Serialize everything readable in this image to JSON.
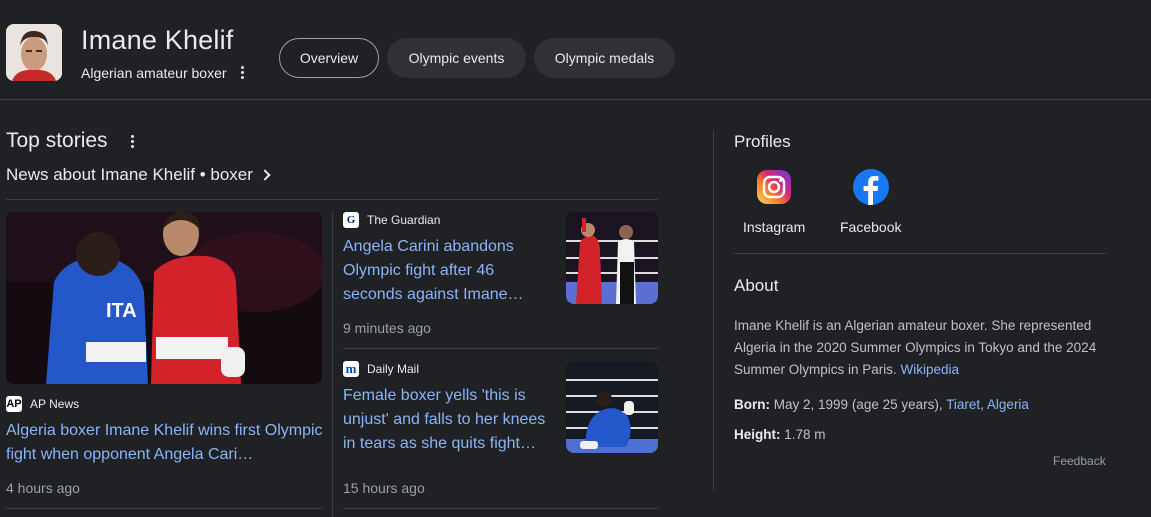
{
  "entity": {
    "name": "Imane Khelif",
    "subtitle": "Algerian amateur boxer"
  },
  "tabs": [
    {
      "label": "Overview",
      "active": true
    },
    {
      "label": "Olympic events",
      "active": false
    },
    {
      "label": "Olympic medals",
      "active": false
    }
  ],
  "top_stories": {
    "title": "Top stories",
    "news_about": "News about Imane Khelif • boxer",
    "stories": [
      {
        "source": "AP News",
        "headline": "Algeria boxer Imane Khelif wins first Olympic fight when opponent Angela Cari…",
        "time": "4 hours ago"
      },
      {
        "source": "The Guardian",
        "headline": "Angela Carini abandons Olympic fight after 46 seconds against Imane…",
        "time": "9 minutes ago"
      },
      {
        "source": "Daily Mail",
        "headline": "Female boxer yells 'this is unjust' and falls to her knees in tears as she quits fight…",
        "time": "15 hours ago"
      }
    ]
  },
  "profiles": {
    "title": "Profiles",
    "items": [
      {
        "label": "Instagram",
        "icon": "instagram-icon"
      },
      {
        "label": "Facebook",
        "icon": "facebook-icon"
      }
    ]
  },
  "about": {
    "title": "About",
    "text": "Imane Khelif is an Algerian amateur boxer. She represented Algeria in the 2020 Summer Olympics in Tokyo and the 2024 Summer Olympics in Paris.",
    "wiki_link": "Wikipedia",
    "born_label": "Born:",
    "born_value": "May 2, 1999 (age 25 years),",
    "born_place_1": "Tiaret",
    "born_place_sep": ",",
    "born_place_2": "Algeria",
    "height_label": "Height:",
    "height_value": "1.78 m"
  },
  "feedback": "Feedback",
  "colors": {
    "background": "#202124",
    "link": "#8ab4f8",
    "muted": "#9aa0a6",
    "chip": "#303134"
  }
}
